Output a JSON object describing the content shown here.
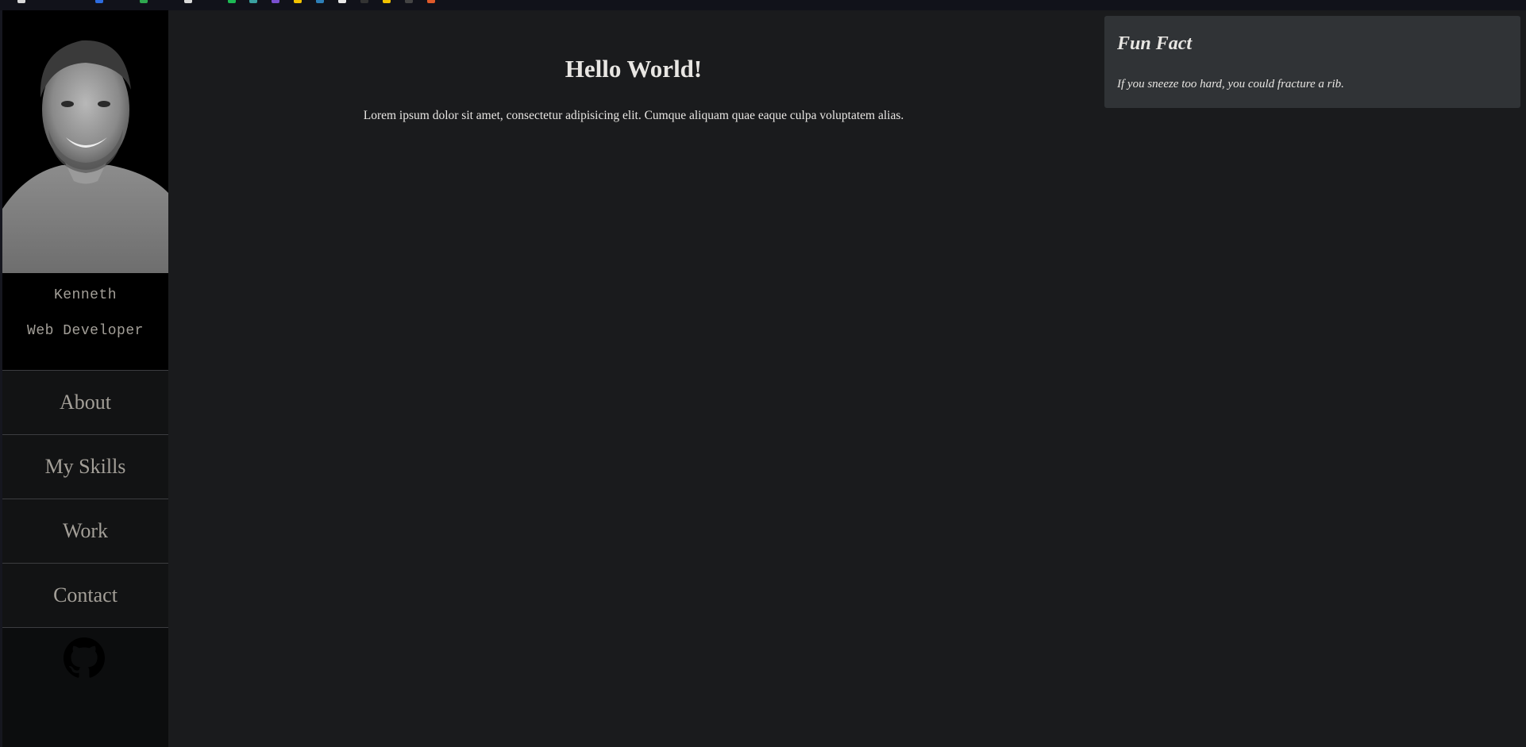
{
  "profile": {
    "name": "Kenneth",
    "role": "Web Developer"
  },
  "nav": {
    "items": [
      {
        "label": "About"
      },
      {
        "label": "My Skills"
      },
      {
        "label": "Work"
      },
      {
        "label": "Contact"
      }
    ],
    "github_icon": "github-icon"
  },
  "main": {
    "title": "Hello World!",
    "text": "Lorem ipsum dolor sit amet, consectetur adipisicing elit. Cumque aliquam quae eaque culpa voluptatem alias."
  },
  "fun_fact": {
    "title": "Fun Fact",
    "text": "If you sneeze too hard, you could fracture a rib."
  },
  "colors": {
    "page_bg": "#1a1b1d",
    "sidebar_bg": "#0c0d0e",
    "nav_text": "#a39f98",
    "card_bg": "#303336",
    "text": "#e8e6e3"
  }
}
